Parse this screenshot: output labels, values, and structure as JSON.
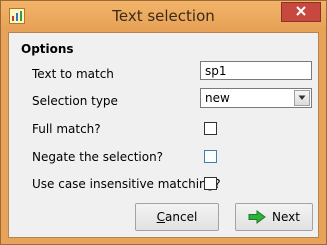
{
  "window": {
    "title": "Text selection",
    "icon": "app-chart-icon",
    "close_icon": "close-icon"
  },
  "options": {
    "group_title": "Options",
    "text_to_match": {
      "label": "Text to match",
      "value": "sp1"
    },
    "selection_type": {
      "label": "Selection type",
      "value": "new"
    },
    "full_match": {
      "label": "Full match?",
      "checked": false
    },
    "negate": {
      "label": "Negate the selection?",
      "checked": false
    },
    "case_insensitive": {
      "label": "Use case insensitive matching?",
      "checked": false
    }
  },
  "buttons": {
    "cancel": {
      "label_prefix": "",
      "label_underlined": "C",
      "label_rest": "ancel"
    },
    "next": {
      "label": "Next",
      "icon": "arrow-right-icon"
    }
  },
  "colors": {
    "titlebar": "#f0ac5f",
    "close_button": "#c7483f",
    "dialog_bg": "#f0f0f0",
    "next_arrow": "#2db33b"
  }
}
